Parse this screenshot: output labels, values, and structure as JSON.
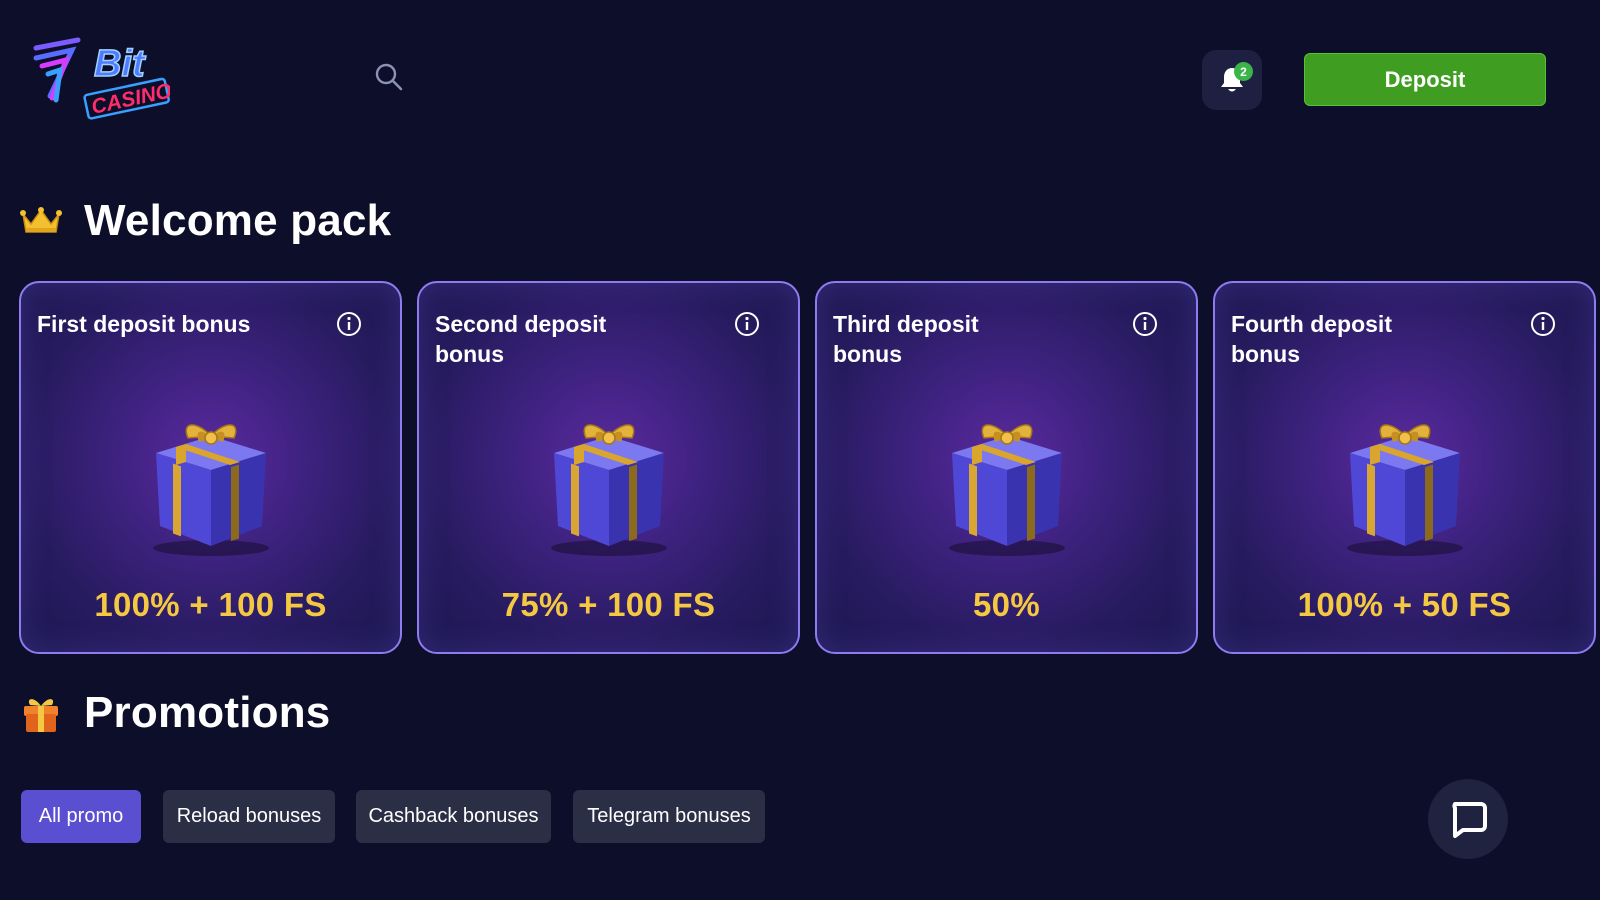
{
  "header": {
    "logo_text_top": "Bit",
    "logo_text_bottom": "CASINO",
    "notifications_count": "2",
    "deposit_label": "Deposit"
  },
  "welcome": {
    "title": "Welcome pack",
    "cards": [
      {
        "title": "First deposit bonus",
        "value": "100% + 100 FS"
      },
      {
        "title": "Second deposit bonus",
        "value": "75% + 100 FS"
      },
      {
        "title": "Third deposit bonus",
        "value": "50%"
      },
      {
        "title": "Fourth deposit bonus",
        "value": "100% + 50 FS"
      }
    ]
  },
  "promotions": {
    "title": "Promotions",
    "filters": [
      {
        "label": "All promo",
        "active": true
      },
      {
        "label": "Reload bonuses",
        "active": false
      },
      {
        "label": "Cashback bonuses",
        "active": false
      },
      {
        "label": "Telegram bonuses",
        "active": false
      }
    ]
  },
  "colors": {
    "background": "#0c0e2a",
    "deposit_green": "#3f9e22",
    "accent_purple": "#5a4fd0",
    "bonus_gold": "#f5c842",
    "card_border": "#8f7bf0"
  },
  "icons": [
    "search-icon",
    "bell-icon",
    "crown-icon",
    "gift-icon",
    "info-icon",
    "chat-icon"
  ]
}
